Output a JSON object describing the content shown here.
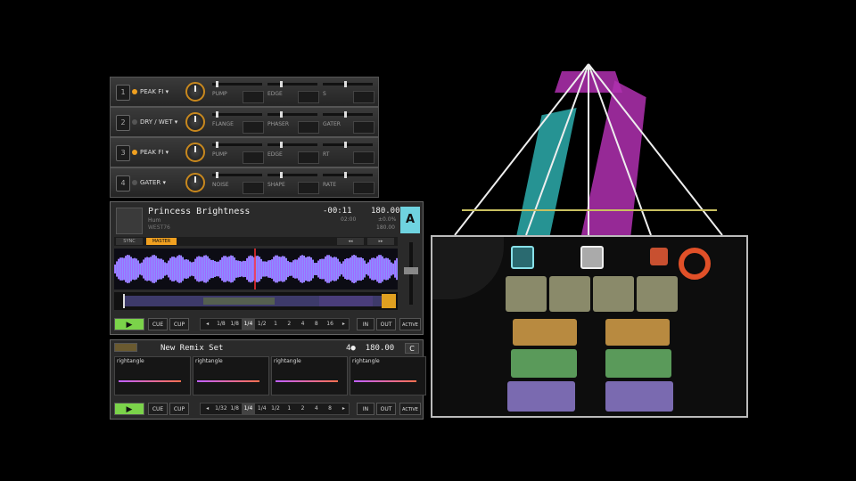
{
  "fx_units": [
    {
      "num": "1",
      "selector": "PEAK FI",
      "led": "on",
      "params": [
        "PUMP",
        "EDGE",
        "S"
      ]
    },
    {
      "num": "2",
      "selector": "DRY / WET",
      "led": "off",
      "params": [
        "FLANGE",
        "PHASER",
        "GATER"
      ]
    },
    {
      "num": "3",
      "selector": "PEAK FI",
      "led": "on",
      "params": [
        "PUMP",
        "EDGE",
        "RT"
      ]
    },
    {
      "num": "4",
      "selector": "GATER",
      "led": "off",
      "params": [
        "NOISE",
        "SHAPE",
        "RATE"
      ]
    }
  ],
  "deck_a": {
    "title": "Princess Brightness",
    "artist": "Hum",
    "key": "WEST76",
    "time": "-00:11",
    "bpm": "180.00",
    "time_sub": "02:00",
    "pitch": "±0.0%",
    "tempo_sub": "180.00",
    "deck_letter": "A",
    "tabs": [
      "SYNC",
      "MASTER"
    ],
    "buttons": {
      "play": "▶",
      "cue": "CUE",
      "cup": "CUP",
      "in": "IN",
      "out": "OUT",
      "active": "ACTIVE"
    },
    "loop_values": [
      "◂",
      "1/8",
      "1/8",
      "1/4",
      "1/2",
      "1",
      "2",
      "4",
      "8",
      "16",
      "▸"
    ],
    "selected_loop": "1/4"
  },
  "remix_deck": {
    "title": "New Remix Set",
    "beat": "4●",
    "bpm": "180.00",
    "letter": "C",
    "slots": [
      "rightangle",
      "rightangle",
      "rightangle",
      "rightangle"
    ],
    "buttons": {
      "play": "▶",
      "cue": "CUE",
      "cup": "CUP",
      "in": "IN",
      "out": "OUT",
      "active": "ACTIVE"
    },
    "loop_values": [
      "◂",
      "1/32",
      "1/8",
      "1/4",
      "1/4",
      "1/2",
      "1",
      "2",
      "4",
      "8",
      "▸"
    ],
    "selected_loop": "1/4"
  },
  "colors": {
    "accent": "#f0a020",
    "deck_a": "#6fd3e0",
    "play": "#7bd34a",
    "magenta": "#c030c0",
    "cyan": "#30c8c8"
  }
}
